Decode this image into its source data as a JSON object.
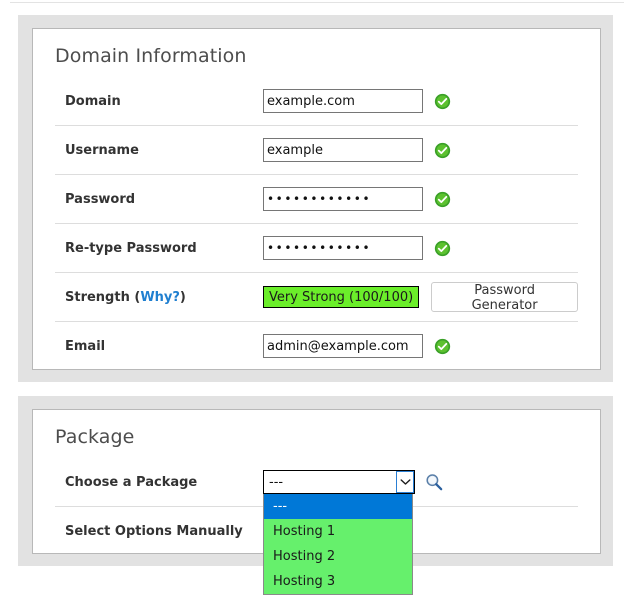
{
  "domain_panel": {
    "title": "Domain Information",
    "rows": [
      {
        "label": "Domain",
        "value": "example.com",
        "status_icon": "green-check-icon"
      },
      {
        "label": "Username",
        "value": "example",
        "status_icon": "green-check-icon"
      },
      {
        "label": "Password",
        "value": "••••••••••••",
        "status_icon": "green-check-icon"
      },
      {
        "label": "Re-type Password",
        "value": "••••••••••••",
        "status_icon": "green-check-icon"
      },
      {
        "label": "Email",
        "value": "admin@example.com",
        "status_icon": "green-check-icon"
      }
    ],
    "strength": {
      "label_prefix": "Strength (",
      "label_link": "Why?",
      "label_suffix": ")",
      "badge_text": "Very Strong (100/100)",
      "badge_color": "#6bee2a",
      "generator_button": "Password Generator"
    }
  },
  "package_panel": {
    "title": "Package",
    "choose_label": "Choose a Package",
    "select_value": "---",
    "search_icon": "magnifier-icon",
    "dropdown_open": true,
    "options": [
      {
        "label": "---",
        "selected": true
      },
      {
        "label": "Hosting 1",
        "selected": false
      },
      {
        "label": "Hosting 2",
        "selected": false
      },
      {
        "label": "Hosting 3",
        "selected": false
      }
    ],
    "manual_label": "Select Options Manually",
    "colors": {
      "highlight": "#0078d7",
      "option_bg": "#66f06c"
    }
  }
}
